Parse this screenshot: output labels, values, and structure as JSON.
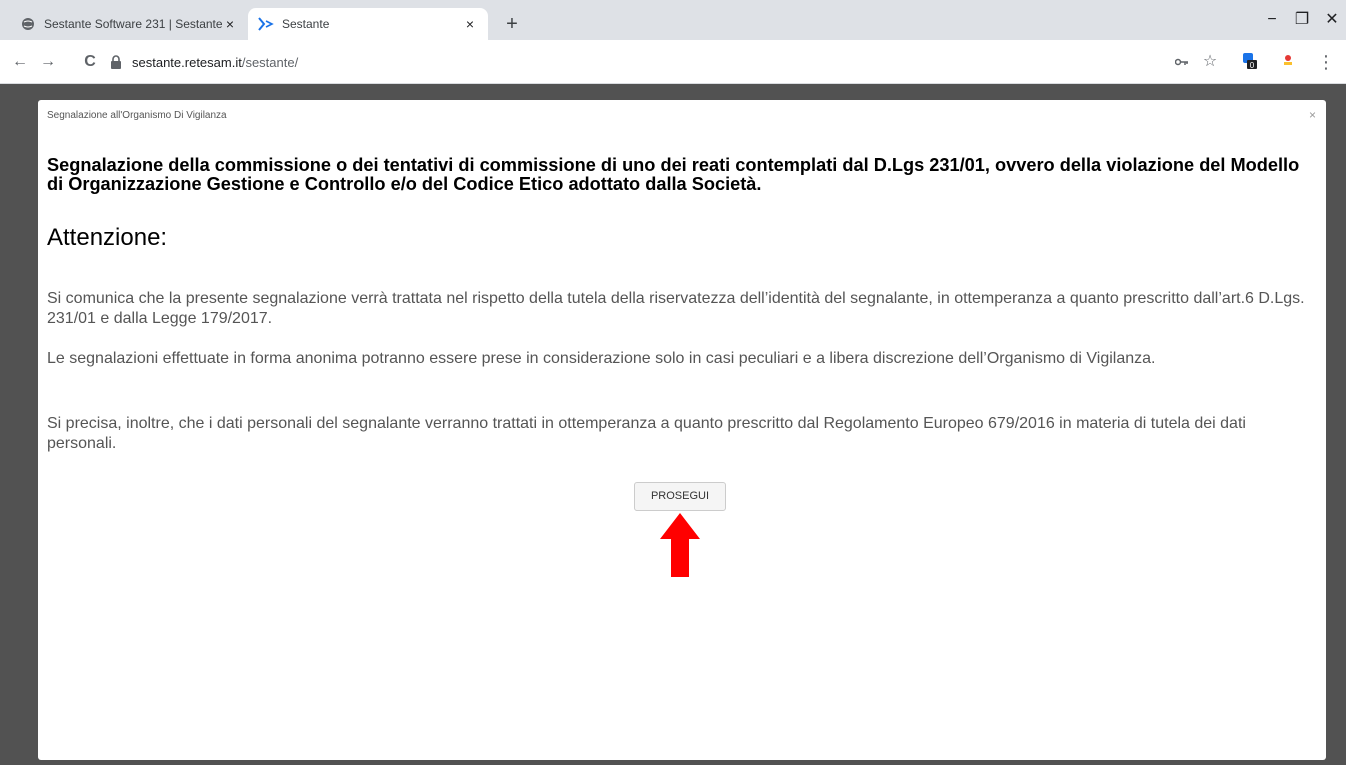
{
  "browser": {
    "tabs": [
      {
        "title": "Sestante Software 231 | Sestante",
        "close": "×"
      },
      {
        "title": "Sestante",
        "close": "×"
      }
    ],
    "new_tab": "+",
    "window_controls": {
      "minimize": "−",
      "restore": "❐",
      "close": "✕"
    },
    "nav": {
      "back": "←",
      "forward": "→",
      "reload": "C"
    },
    "url": {
      "host": "sestante.retesam.it",
      "path": "/sestante/"
    },
    "toolbar_icons": {
      "key": "🔑",
      "star": "☆",
      "menu": "⋮"
    }
  },
  "modal": {
    "header": "Segnalazione all'Organismo Di Vigilanza",
    "close": "×",
    "subject": "Segnalazione della commissione o dei tentativi di commissione di uno dei reati contemplati dal D.Lgs 231/01, ovvero della violazione del Modello di Organizzazione Gestione e Controllo e/o del Codice Etico adottato dalla Società.",
    "attention": "Attenzione:",
    "paragraphs": [
      "Si comunica che la presente segnalazione verrà trattata nel rispetto della tutela della riservatezza dell’identità del segnalante, in ottemperanza a quanto prescritto dall’art.6 D.Lgs. 231/01 e dalla Legge 179/2017.",
      "Le segnalazioni effettuate in forma anonima potranno essere prese in considerazione solo in casi peculiari e a libera discrezione dell’Organismo di Vigilanza.",
      "Si precisa, inoltre, che i dati personali del segnalante verranno trattati in ottemperanza a quanto prescritto dal Regolamento Europeo 679/2016 in materia di tutela dei dati personali."
    ],
    "button": "PROSEGUI"
  },
  "colors": {
    "arrow": "#ff0000",
    "tab_active_icon": "#1a73e8"
  }
}
